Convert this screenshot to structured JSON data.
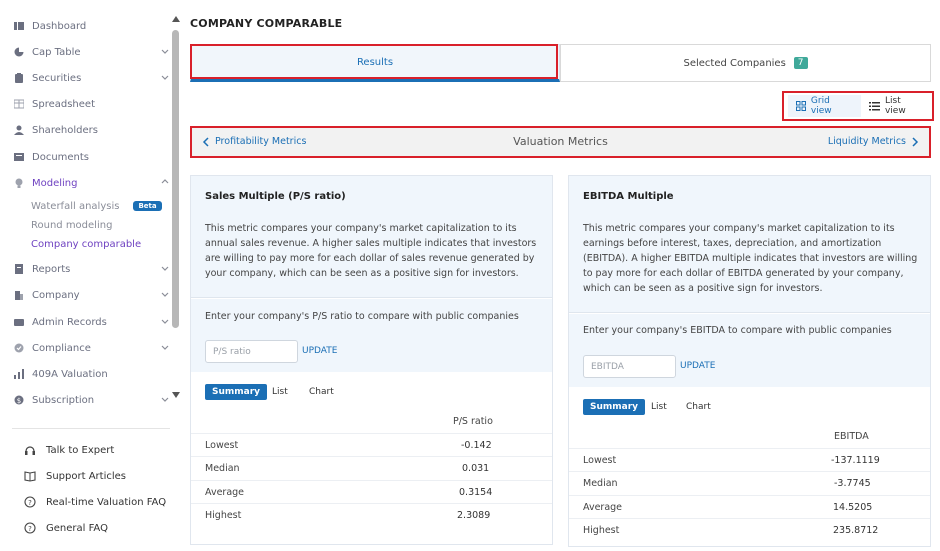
{
  "sidebar": {
    "items": [
      {
        "label": "Dashboard",
        "icon": "dashboard-icon"
      },
      {
        "label": "Cap Table",
        "icon": "pie-chart-icon"
      },
      {
        "label": "Securities",
        "icon": "clipboard-icon"
      },
      {
        "label": "Spreadsheet",
        "icon": "spreadsheet-icon"
      },
      {
        "label": "Shareholders",
        "icon": "person-icon"
      },
      {
        "label": "Documents",
        "icon": "documents-icon"
      },
      {
        "label": "Modeling",
        "icon": "bulb-icon"
      },
      {
        "label": "Reports",
        "icon": "report-icon"
      },
      {
        "label": "Company",
        "icon": "building-icon"
      },
      {
        "label": "Admin Records",
        "icon": "admin-icon"
      },
      {
        "label": "Compliance",
        "icon": "shield-icon"
      },
      {
        "label": "409A Valuation",
        "icon": "valuation-icon"
      },
      {
        "label": "Subscription",
        "icon": "dollar-icon"
      }
    ],
    "modeling_sub": [
      {
        "label": "Waterfall analysis",
        "badge": "Beta"
      },
      {
        "label": "Round modeling"
      },
      {
        "label": "Company comparable"
      }
    ],
    "footer": [
      {
        "label": "Talk to Expert",
        "icon": "headset-icon"
      },
      {
        "label": "Support Articles",
        "icon": "book-icon"
      },
      {
        "label": "Real-time Valuation FAQ",
        "icon": "help-circle-icon"
      },
      {
        "label": "General FAQ",
        "icon": "help-circle-icon"
      }
    ]
  },
  "main": {
    "title": "COMPANY COMPARABLE",
    "tabs": [
      {
        "label": "Results"
      },
      {
        "label": "Selected Companies",
        "count": "7"
      }
    ],
    "view_toggle": {
      "grid": "Grid view",
      "list": "List view"
    },
    "metrics_nav": {
      "prev": "Profitability Metrics",
      "current": "Valuation Metrics",
      "next": "Liquidity Metrics"
    },
    "cards": [
      {
        "title": "Sales Multiple (P/S ratio)",
        "description": "This metric compares your company's market capitalization to its annual sales revenue. A higher sales multiple indicates that investors are willing to pay more for each dollar of sales revenue generated by your company, which can be seen as a positive sign for investors.",
        "prompt": "Enter your company's P/S ratio to compare with public companies",
        "placeholder": "P/S ratio",
        "update": "UPDATE",
        "subtabs": [
          "Summary",
          "List",
          "Chart"
        ],
        "column": "P/S ratio",
        "rows": [
          {
            "label": "Lowest",
            "value": "-0.142"
          },
          {
            "label": "Median",
            "value": "0.031"
          },
          {
            "label": "Average",
            "value": "0.3154"
          },
          {
            "label": "Highest",
            "value": "2.3089"
          }
        ]
      },
      {
        "title": "EBITDA Multiple",
        "description": "This metric compares your company's market capitalization to its earnings before interest, taxes, depreciation, and amortization (EBITDA). A higher EBITDA multiple indicates that investors are willing to pay more for each dollar of EBITDA generated by your company, which can be seen as a positive sign for investors.",
        "prompt": "Enter your company's EBITDA to compare with public companies",
        "placeholder": "EBITDA",
        "update": "UPDATE",
        "subtabs": [
          "Summary",
          "List",
          "Chart"
        ],
        "column": "EBITDA",
        "rows": [
          {
            "label": "Lowest",
            "value": "-137.1119"
          },
          {
            "label": "Median",
            "value": "-3.7745"
          },
          {
            "label": "Average",
            "value": "14.5205"
          },
          {
            "label": "Highest",
            "value": "235.8712"
          }
        ]
      }
    ]
  },
  "colors": {
    "accent": "#1b6fb5",
    "modeling_active": "#6f42c1",
    "highlight_box": "#d9202a",
    "badge_teal": "#3fa99a"
  }
}
